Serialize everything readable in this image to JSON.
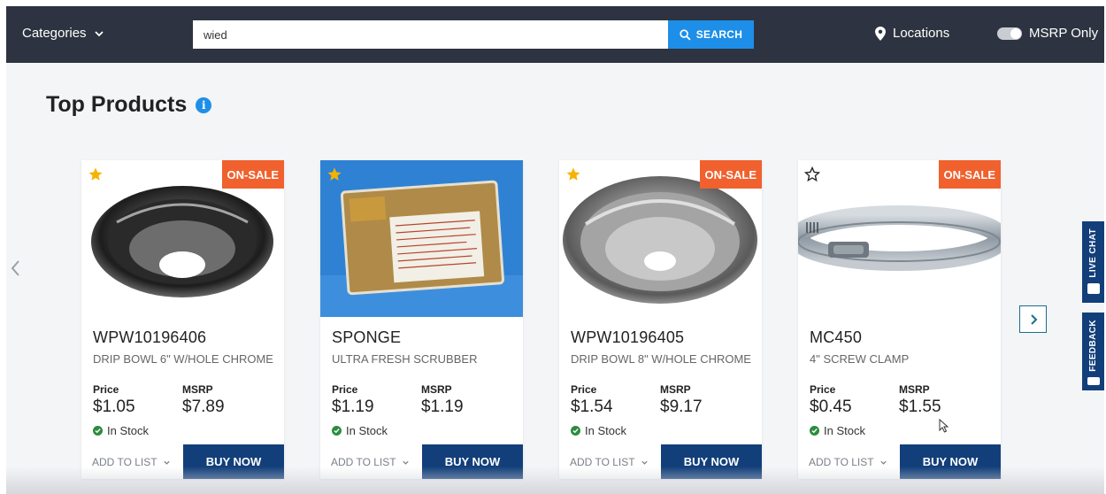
{
  "header": {
    "categories_label": "Categories",
    "search_value": "wied",
    "search_button_label": "SEARCH",
    "locations_label": "Locations",
    "msrp_toggle_label": "MSRP Only"
  },
  "section": {
    "title": "Top Products",
    "info_glyph": "i"
  },
  "products": [
    {
      "part_number": "WPW10196406",
      "description": "DRIP BOWL 6\" W/HOLE CHROME",
      "price_label": "Price",
      "price": "$1.05",
      "msrp_label": "MSRP",
      "msrp": "$7.89",
      "stock": "In Stock",
      "add_to_list": "ADD TO LIST",
      "buy_now": "BUY NOW",
      "badge": "ON-SALE",
      "favorited": true
    },
    {
      "part_number": "SPONGE",
      "description": "ULTRA FRESH SCRUBBER",
      "price_label": "Price",
      "price": "$1.19",
      "msrp_label": "MSRP",
      "msrp": "$1.19",
      "stock": "In Stock",
      "add_to_list": "ADD TO LIST",
      "buy_now": "BUY NOW",
      "badge": "",
      "favorited": true
    },
    {
      "part_number": "WPW10196405",
      "description": "DRIP BOWL 8\" W/HOLE CHROME",
      "price_label": "Price",
      "price": "$1.54",
      "msrp_label": "MSRP",
      "msrp": "$9.17",
      "stock": "In Stock",
      "add_to_list": "ADD TO LIST",
      "buy_now": "BUY NOW",
      "badge": "ON-SALE",
      "favorited": true
    },
    {
      "part_number": "MC450",
      "description": "4\" SCREW CLAMP",
      "price_label": "Price",
      "price": "$0.45",
      "msrp_label": "MSRP",
      "msrp": "$1.55",
      "stock": "In Stock",
      "add_to_list": "ADD TO LIST",
      "buy_now": "BUY NOW",
      "badge": "ON-SALE",
      "favorited": false
    }
  ],
  "side_tabs": {
    "live_chat": "LIVE CHAT",
    "feedback": "FEEDBACK"
  },
  "colors": {
    "topbar": "#2d3340",
    "search_accent": "#1e8fe8",
    "sale_badge": "#f0612e",
    "buy_now": "#123f7a",
    "star_filled": "#f5b301",
    "in_stock": "#2e8b3e"
  },
  "icons": {
    "categories": "chevron-down-icon",
    "search": "magnifier-icon",
    "locations": "map-pin-icon",
    "favorite": "star-icon",
    "carousel_prev": "chevron-left-icon",
    "carousel_next": "chevron-right-icon",
    "in_stock": "check-circle-icon"
  }
}
